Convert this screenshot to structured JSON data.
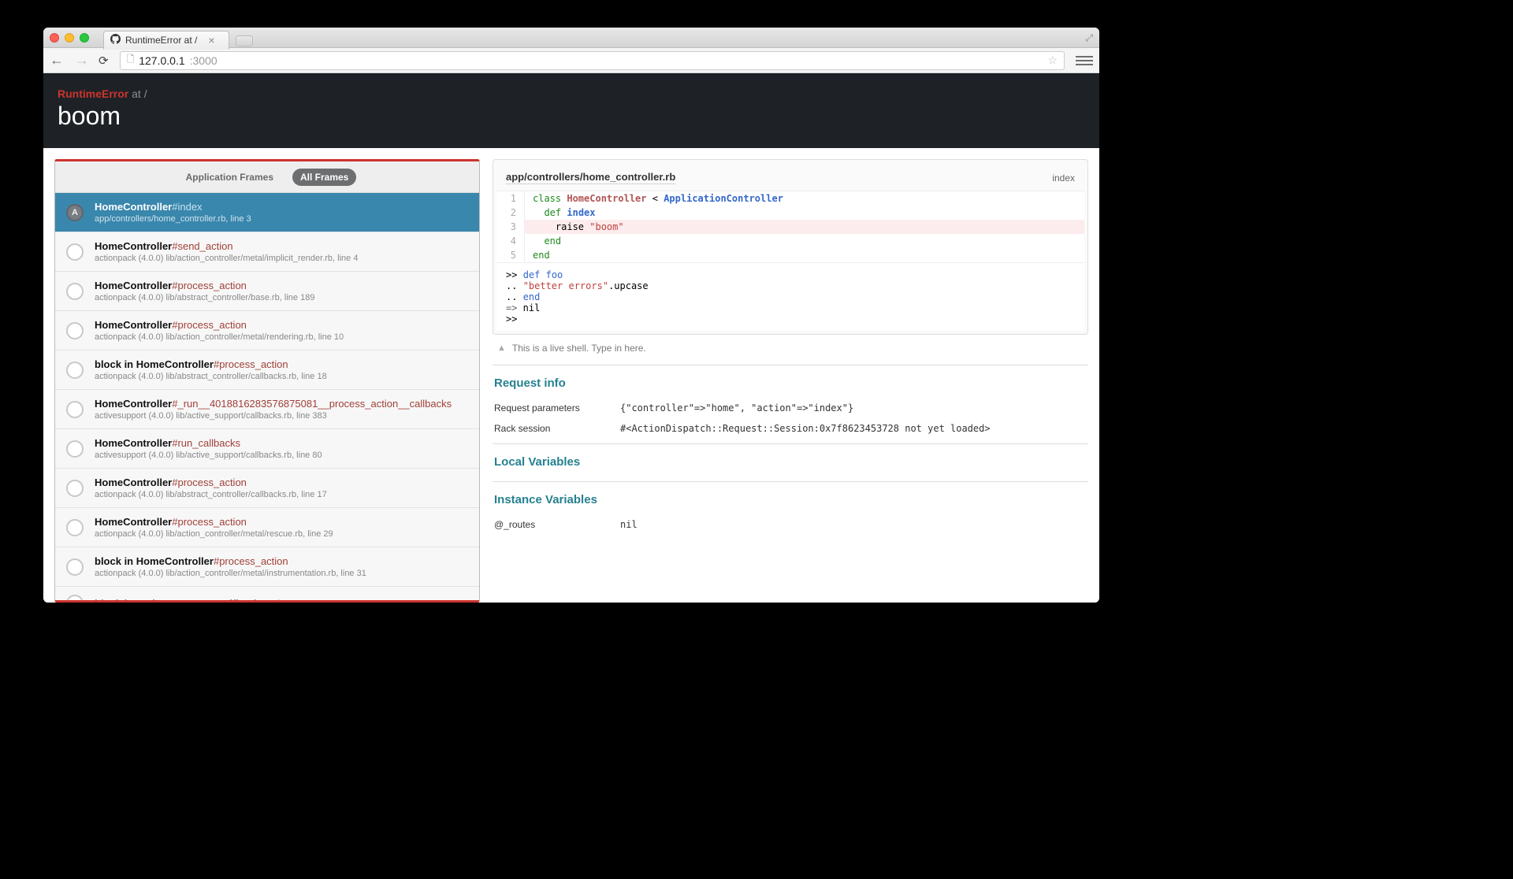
{
  "browser": {
    "tab_title": "RuntimeError at /",
    "url_host": "127.0.0.1",
    "url_port": ":3000"
  },
  "header": {
    "error_type": "RuntimeError",
    "at_label": "at /",
    "message": "boom"
  },
  "frames": {
    "tabs": {
      "app": "Application Frames",
      "all": "All Frames"
    },
    "list": [
      {
        "selected": true,
        "app": true,
        "class": "HomeController",
        "method": "#index",
        "loc": "app/controllers/home_controller.rb, line 3"
      },
      {
        "class": "HomeController",
        "method": "#send_action",
        "loc": "actionpack (4.0.0) lib/action_controller/metal/implicit_render.rb, line 4"
      },
      {
        "class": "HomeController",
        "method": "#process_action",
        "loc": "actionpack (4.0.0) lib/abstract_controller/base.rb, line 189"
      },
      {
        "class": "HomeController",
        "method": "#process_action",
        "loc": "actionpack (4.0.0) lib/action_controller/metal/rendering.rb, line 10"
      },
      {
        "class": "block in HomeController",
        "method": "#process_action",
        "loc": "actionpack (4.0.0) lib/abstract_controller/callbacks.rb, line 18"
      },
      {
        "class": "HomeController",
        "method": "#_run__4018816283576875081__process_action__callbacks",
        "loc": "activesupport (4.0.0) lib/active_support/callbacks.rb, line 383"
      },
      {
        "class": "HomeController",
        "method": "#run_callbacks",
        "loc": "activesupport (4.0.0) lib/active_support/callbacks.rb, line 80"
      },
      {
        "class": "HomeController",
        "method": "#process_action",
        "loc": "actionpack (4.0.0) lib/abstract_controller/callbacks.rb, line 17"
      },
      {
        "class": "HomeController",
        "method": "#process_action",
        "loc": "actionpack (4.0.0) lib/action_controller/metal/rescue.rb, line 29"
      },
      {
        "class": "block in HomeController",
        "method": "#process_action",
        "loc": "actionpack (4.0.0) lib/action_controller/metal/instrumentation.rb, line 31"
      },
      {
        "class": "block in ActiveSupport::Notifications",
        "method": ".instrument",
        "loc": ""
      }
    ]
  },
  "source": {
    "file": "app/controllers/home_controller.rb",
    "method": "index",
    "lines": [
      {
        "n": "1",
        "html": "<span class='kw'>class</span> <span class='cls'>HomeController</span> &lt; <span class='acls'>ApplicationController</span>"
      },
      {
        "n": "2",
        "html": "  <span class='kw'>def</span> <span class='acls'>index</span>"
      },
      {
        "n": "3",
        "hl": true,
        "html": "    raise <span class='str'>\"boom\"</span>"
      },
      {
        "n": "4",
        "html": "  <span class='kw'>end</span>"
      },
      {
        "n": "5",
        "html": "<span class='kw'>end</span>"
      }
    ]
  },
  "repl": [
    "&gt;&gt; <span class='p-blue'>def</span> <span class='p-blue'>foo</span>",
    "..   <span class='p-str'>\"better errors\"</span>.upcase",
    ".. <span class='p-blue'>end</span>",
    "<span class='p-arrow'>=&gt;</span> nil",
    "&gt;&gt;"
  ],
  "hint": "This is a live shell. Type in here.",
  "sections": {
    "request_info": {
      "title": "Request info",
      "rows": [
        {
          "k": "Request parameters",
          "v": "{\"controller\"=>\"home\", \"action\"=>\"index\"}"
        },
        {
          "k": "Rack session",
          "v": "#<ActionDispatch::Request::Session:0x7f8623453728 not yet loaded>"
        }
      ]
    },
    "local_vars": {
      "title": "Local Variables"
    },
    "instance_vars": {
      "title": "Instance Variables",
      "rows": [
        {
          "k": "@_routes",
          "v": "nil"
        }
      ]
    }
  }
}
